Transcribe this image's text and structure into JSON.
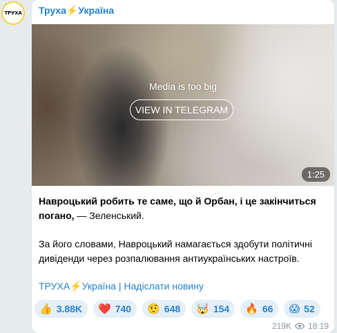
{
  "avatar": {
    "text": "ТРУХА",
    "icon": "channel-avatar-icon",
    "ring_color": "#f7d13b"
  },
  "channel": {
    "name_prefix": "Труха",
    "bolt": "⚡",
    "name_suffix": "Україна",
    "color": "#2481cc"
  },
  "media": {
    "message": "Media is too big",
    "button_label": "VIEW IN TELEGRAM",
    "duration": "1:25"
  },
  "post": {
    "headline_bold": "Навроцький робить те саме, що й Орбан, і це закінчиться погано,",
    "headline_rest": " — Зеленський.",
    "body": "За його словами, Навроцький намагається здобути політичні дивіденди через розпалювання антиукраїнських настроїв."
  },
  "footer": {
    "name_prefix": "ТРУХА",
    "bolt": "⚡",
    "name_suffix": "Україна",
    "separator": " | ",
    "submit_link": "Надіслати новину"
  },
  "reactions": [
    {
      "emoji": "👍",
      "icon": "thumbs-up-icon",
      "count": "3.88K"
    },
    {
      "emoji": "❤️",
      "icon": "heart-icon",
      "count": "740"
    },
    {
      "emoji": "🤨",
      "icon": "raised-eyebrow-icon",
      "count": "648"
    },
    {
      "emoji": "🤯",
      "icon": "exploding-head-icon",
      "count": "154"
    },
    {
      "emoji": "🔥",
      "icon": "fire-icon",
      "count": "66"
    },
    {
      "emoji": "😱",
      "icon": "screaming-face-icon",
      "count": "52"
    }
  ],
  "meta": {
    "views": "219K",
    "time": "18:19",
    "icon": "eye-icon"
  }
}
